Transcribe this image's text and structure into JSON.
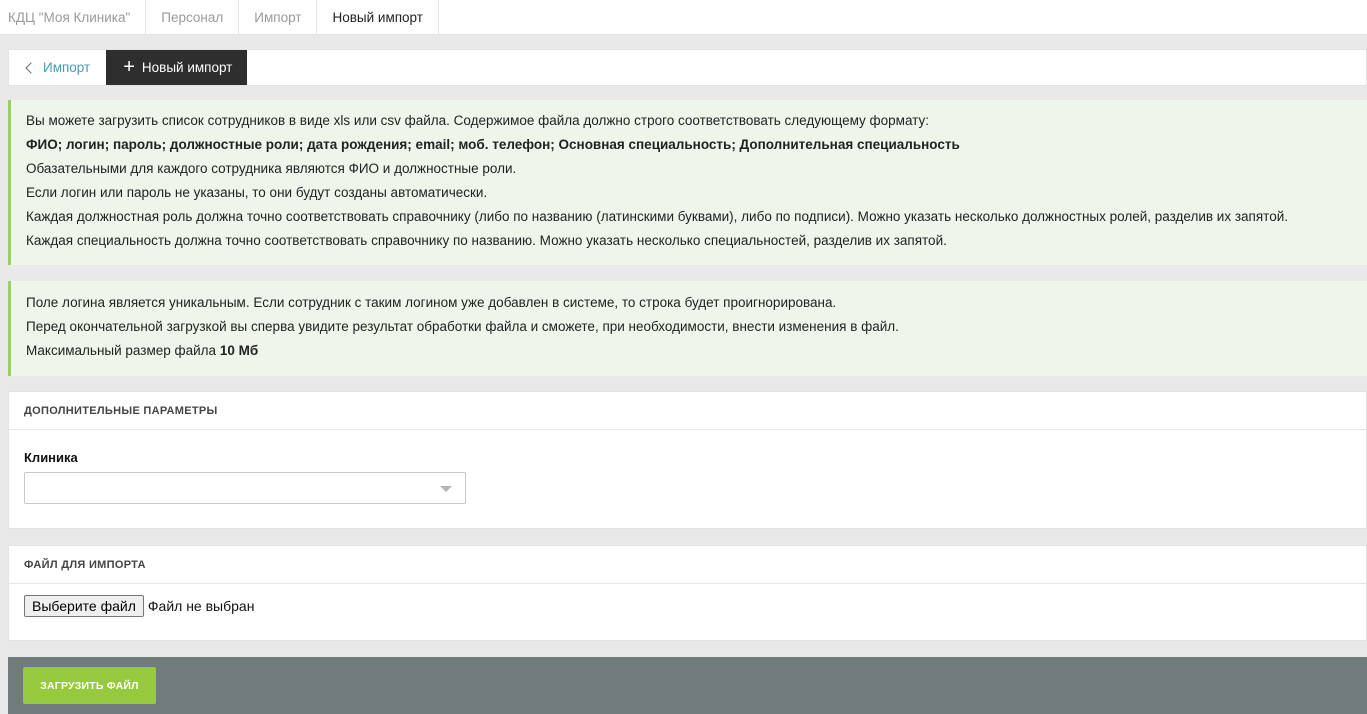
{
  "breadcrumbs": [
    {
      "label": "КДЦ \"Моя Клиника\""
    },
    {
      "label": "Персонал"
    },
    {
      "label": "Импорт"
    },
    {
      "label": "Новый импорт"
    }
  ],
  "tabs": {
    "back_label": "Импорт",
    "new_label": "Новый импорт"
  },
  "info1": {
    "line1": "Вы можете загрузить список сотрудников в виде xls или csv файла. Содержимое файла должно строго соответствовать следующему формату:",
    "line2": "ФИО; логин; пароль; должностные роли; дата рождения; email; моб. телефон; Основная специальность; Дополнительная специальность",
    "line3": "Обазательными для каждого сотрудника являются ФИО и должностные роли.",
    "line4": "Если логин или пароль не указаны, то они будут созданы автоматически.",
    "line5": "Каждая должностная роль должна точно соответствовать справочнику (либо по названию (латинскими буквами), либо по подписи). Можно указать несколько должностных ролей, разделив их запятой.",
    "line6": "Каждая специальность должна точно соответствовать справочнику по названию. Можно указать несколько специальностей, разделив их запятой."
  },
  "info2": {
    "line1": "Поле логина является уникальным. Если сотрудник с таким логином уже добавлен в системе, то строка будет проигнорирована.",
    "line2": "Перед окончательной загрузкой вы сперва увидите результат обработки файла и сможете, при необходимости, внести изменения в файл.",
    "line3_prefix": "Максимальный размер файла ",
    "line3_value": "10 Мб"
  },
  "params": {
    "title": "ДОПОЛНИТЕЛЬНЫЕ ПАРАМЕТРЫ",
    "clinic_label": "Клиника",
    "clinic_value": ""
  },
  "file": {
    "title": "ФАЙЛ ДЛЯ ИМПОРТА",
    "choose_label": "Выберите файл",
    "status": "Файл не выбран"
  },
  "footer": {
    "upload_label": "ЗАГРУЗИТЬ ФАЙЛ"
  },
  "colors": {
    "accent_green": "#96c93d",
    "link_blue": "#4a9bb5",
    "info_bg": "#eef6ec",
    "footer_bg": "#717b7c"
  }
}
